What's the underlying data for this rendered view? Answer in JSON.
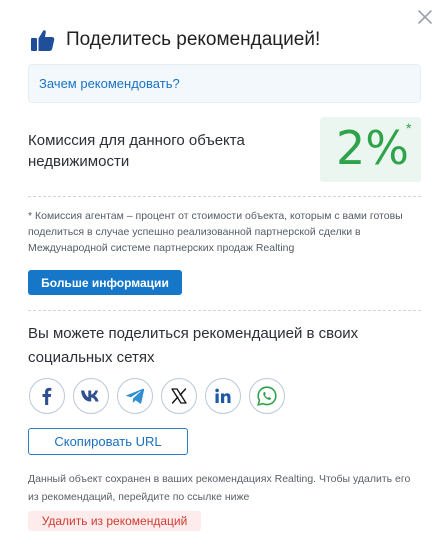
{
  "dialog": {
    "title": "Поделитесь рекомендацией!",
    "icons": {
      "title_icon": "thumbs-up-icon",
      "close_icon": "close-icon"
    }
  },
  "why_link": "Зачем рекомендовать?",
  "commission": {
    "label": "Комиссия для данного объекта недвижимости",
    "value": "2%",
    "footnote_mark": "*"
  },
  "note": "* Комиссия агентам – процент от стоимости объекта, которым с вами готовы поделиться в случае успешно реализованной партнерской сделки в Международной системе партнерских продаж Realting",
  "more_button": "Больше информации",
  "share_text": "Вы можете поделиться рекомендацией в своих социальных сетях",
  "socials": [
    {
      "icon": "facebook-icon",
      "color": "#2f4f8f"
    },
    {
      "icon": "vk-icon",
      "color": "#2f4f8f"
    },
    {
      "icon": "telegram-icon",
      "color": "#2f8fd0"
    },
    {
      "icon": "x-icon",
      "color": "#111111"
    },
    {
      "icon": "linkedin-icon",
      "color": "#1e5aa8"
    },
    {
      "icon": "whatsapp-icon",
      "color": "#2fa34a"
    }
  ],
  "copy_button": "Скопировать URL",
  "saved_note": "Данный объект сохранен в ваших рекомендациях Realting. Чтобы удалить его из рекомендаций, перейдите по ссылке ниже",
  "delete_button": "Удалить из рекомендаций",
  "colors": {
    "accent": "#1677c8",
    "success": "#2fa34a",
    "danger": "#d13a33"
  }
}
